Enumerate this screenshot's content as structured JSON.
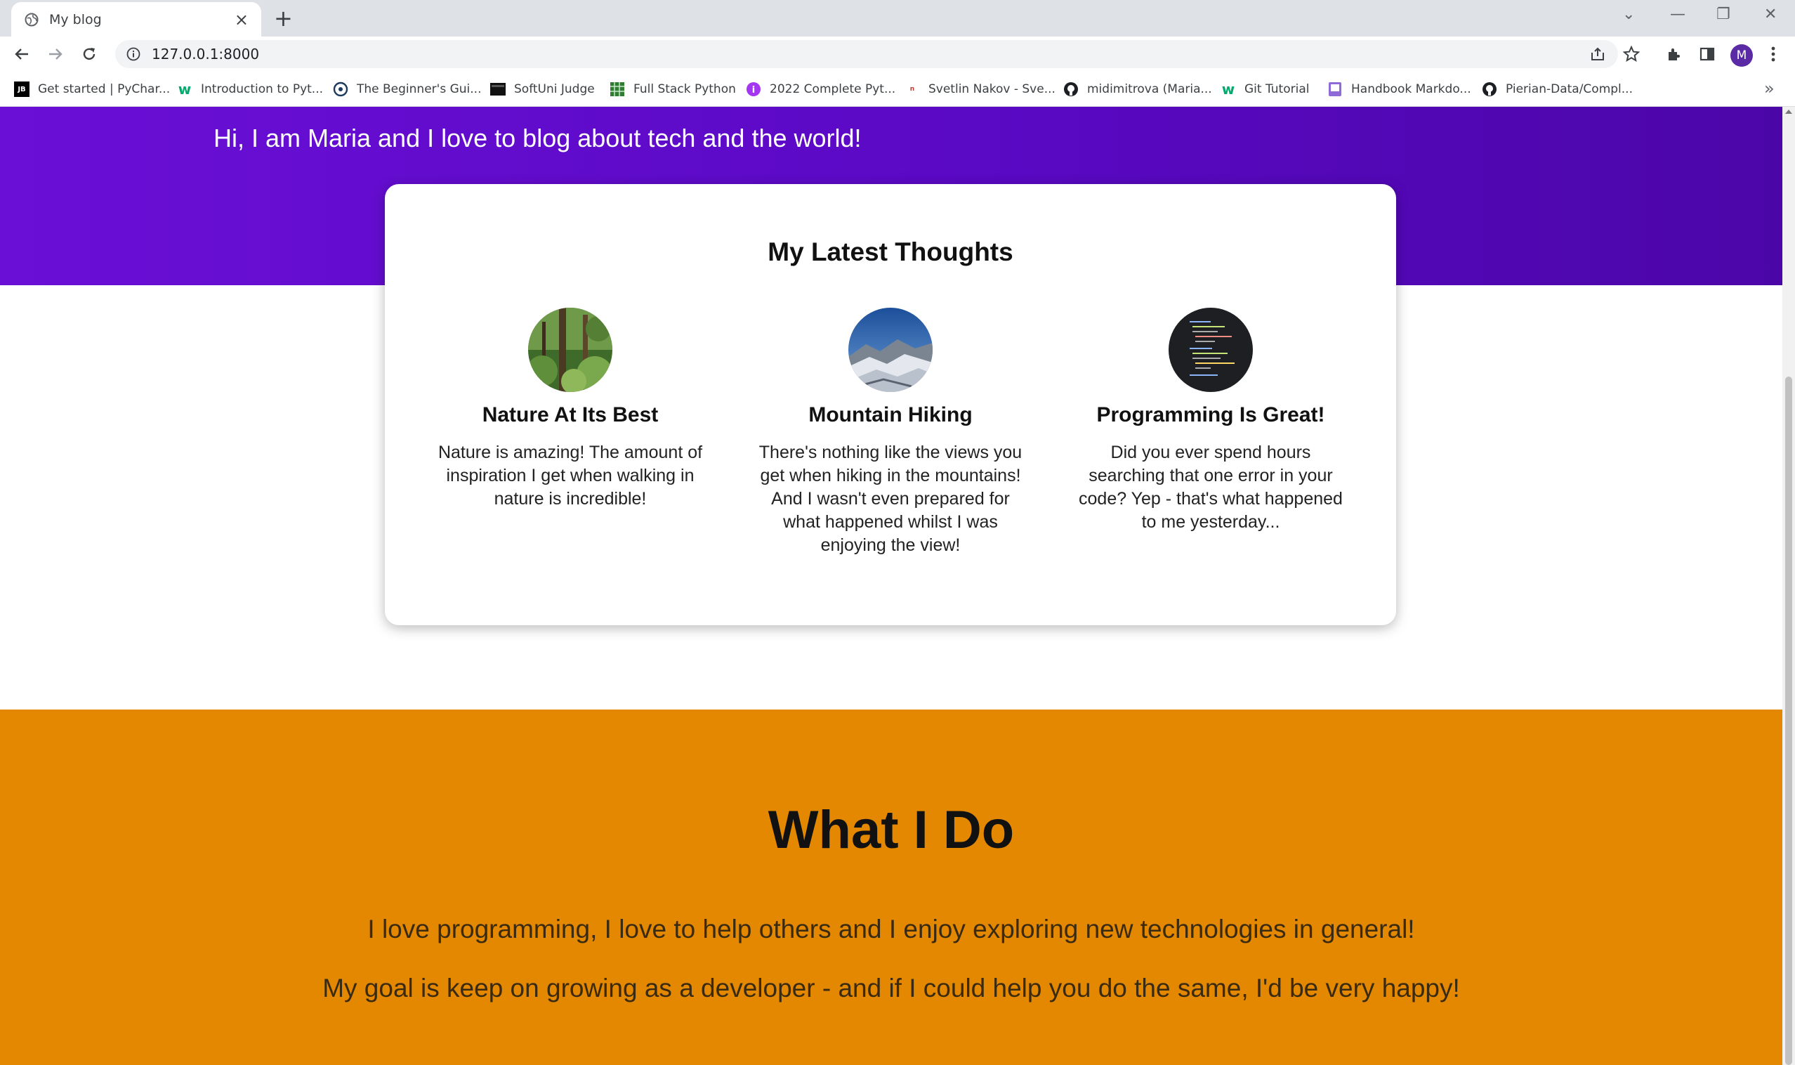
{
  "browser": {
    "tab_title": "My blog",
    "url": "127.0.0.1:8000",
    "profile_initial": "M",
    "bookmarks": [
      {
        "label": "Get started | PyChar...",
        "icon": "jetbrains-icon"
      },
      {
        "label": "Introduction to Pyt...",
        "icon": "w3schools-icon"
      },
      {
        "label": "The Beginner's Gui...",
        "icon": "python-org-icon"
      },
      {
        "label": "SoftUni Judge",
        "icon": "judge-icon"
      },
      {
        "label": "Full Stack Python",
        "icon": "fullstackpython-icon"
      },
      {
        "label": "2022 Complete Pyt...",
        "icon": "udemy-icon"
      },
      {
        "label": "Svetlin Nakov - Sve...",
        "icon": "nakov-icon"
      },
      {
        "label": "midimitrova (Maria...",
        "icon": "github-icon"
      },
      {
        "label": "Git Tutorial",
        "icon": "w3schools-icon"
      },
      {
        "label": "Handbook Markdo...",
        "icon": "markdown-icon"
      },
      {
        "label": "Pierian-Data/Compl...",
        "icon": "github-icon"
      }
    ]
  },
  "hero": {
    "text": "Hi, I am Maria and I love to blog about tech and the world!"
  },
  "latest": {
    "title": "My Latest Thoughts",
    "posts": [
      {
        "title": "Nature At Its Best",
        "description": "Nature is amazing! The amount of inspiration I get when walking in nature is incredible!",
        "image": "forest-image"
      },
      {
        "title": "Mountain Hiking",
        "description": "There's nothing like the views you get when hiking in the mountains! And I wasn't even prepared for what happened whilst I was enjoying the view!",
        "image": "mountain-image"
      },
      {
        "title": "Programming Is Great!",
        "description": "Did you ever spend hours searching that one error in your code? Yep - that's what happened to me yesterday...",
        "image": "code-image"
      }
    ]
  },
  "what_i_do": {
    "title": "What I Do",
    "paragraphs": [
      "I love programming, I love to help others and I enjoy exploring new technologies in general!",
      "My goal is keep on growing as a developer - and if I could help you do the same, I'd be very happy!"
    ]
  },
  "colors": {
    "hero_purple": "#5a09c4",
    "what_i_do_orange": "#e38800"
  }
}
